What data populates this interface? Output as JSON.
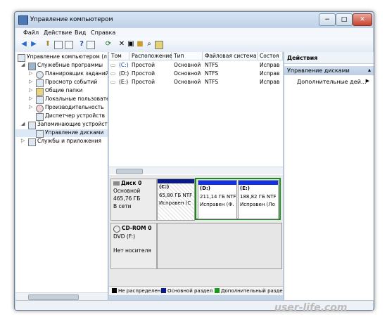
{
  "window": {
    "title": "Управление компьютером",
    "btn_min": "−",
    "btn_max": "□",
    "btn_close": "✕"
  },
  "menu": {
    "items": [
      "Файл",
      "Действие",
      "Вид",
      "Справка"
    ]
  },
  "toolbar": {
    "icons": [
      "back-icon",
      "forward-icon",
      "up-icon",
      "show-tree-icon",
      "properties-icon",
      "help-icon",
      "help-topic-icon",
      "delete-icon",
      "open-icon",
      "folder-icon",
      "search-icon",
      "refresh-icon"
    ]
  },
  "tree": {
    "items": [
      "Управление компьютером (л",
      "Служебные программы",
      "Планировщик заданий",
      "Просмотр событий",
      "Общие папки",
      "Локальные пользовате",
      "Производительность",
      "Диспетчер устройств",
      "Запоминающие устройст",
      "Управление дисками",
      "Службы и приложения"
    ]
  },
  "volumes": {
    "headers": [
      "Том",
      "Расположение",
      "Тип",
      "Файловая система",
      "Состоя"
    ],
    "rows": [
      [
        "(C:)",
        "Простой",
        "Основной",
        "NTFS",
        "Исправ"
      ],
      [
        "(D:)",
        "Простой",
        "Основной",
        "NTFS",
        "Исправ"
      ],
      [
        "(E:)",
        "Простой",
        "Основной",
        "NTFS",
        "Исправ"
      ]
    ]
  },
  "disks": {
    "disk0": {
      "name": "Диск 0",
      "type": "Основной",
      "size": "465,76 ГБ",
      "state": "В сети"
    },
    "cdrom": {
      "name": "CD-ROM 0",
      "type": "DVD (F:)",
      "state": "Нет носителя"
    },
    "partitions": [
      {
        "name": "(C:)",
        "size": "65,80 ГБ NTF",
        "status": "Исправен (С"
      },
      {
        "name": "(D:)",
        "size": "211,14 ГБ NTF",
        "status": "Исправен (Ф."
      },
      {
        "name": "(E:)",
        "size": "188,82 ГБ NTF",
        "status": "Исправен (Ло"
      }
    ]
  },
  "legend": {
    "items": [
      "Не распределен",
      "Основной раздел",
      "Дополнительный разде"
    ],
    "colors": [
      "#000000",
      "#0a1a8a",
      "#1a9a1a"
    ]
  },
  "actions": {
    "header": "Действия",
    "section": "Управление дисками",
    "more": "Дополнительные дей..."
  },
  "watermark": "user-life.com"
}
